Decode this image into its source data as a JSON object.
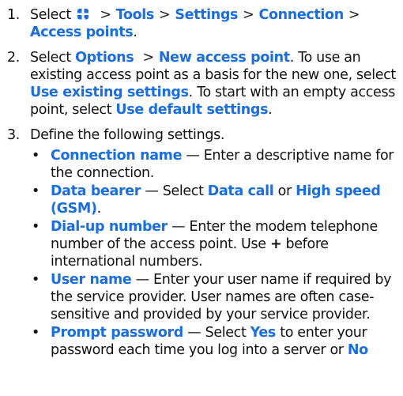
{
  "sep": ">",
  "dash": "—",
  "bullet_char": "•",
  "accent_color": "#1a6ee0",
  "steps": [
    {
      "num": "1.",
      "text_select": "Select",
      "icon": "menu-key-icon",
      "path": [
        "Tools",
        "Settings",
        "Connection",
        "Access points"
      ],
      "end": "."
    },
    {
      "num": "2.",
      "t1": "Select",
      "options": "Options",
      "new_ap": "New access point",
      "t2": ". To use an existing access point as a basis for the new one, select",
      "use_existing": "Use existing settings",
      "t3": ". To start with an empty access point, select",
      "use_default": "Use default settings",
      "t4": "."
    },
    {
      "num": "3.",
      "text": "Define the following settings."
    }
  ],
  "settings": {
    "connection_name": {
      "label": "Connection name",
      "text": "Enter a descriptive name for the connection."
    },
    "data_bearer": {
      "label": "Data bearer",
      "t1": "Select",
      "opt1": "Data call",
      "or": "or",
      "opt2": "High speed (GSM)",
      "end": "."
    },
    "dialup": {
      "label": "Dial-up number",
      "t1": "Enter the modem telephone number of the access point. Use",
      "plus": "+",
      "t2": "before international numbers."
    },
    "username": {
      "label": "User name",
      "text": "Enter your user name if required by the service provider. User names are often case-sensitive and provided by your service provider."
    },
    "prompt": {
      "label": "Prompt password",
      "t1": "Select",
      "yes": "Yes",
      "t2": "to enter your password each time you log into a server or",
      "no": "No"
    }
  }
}
